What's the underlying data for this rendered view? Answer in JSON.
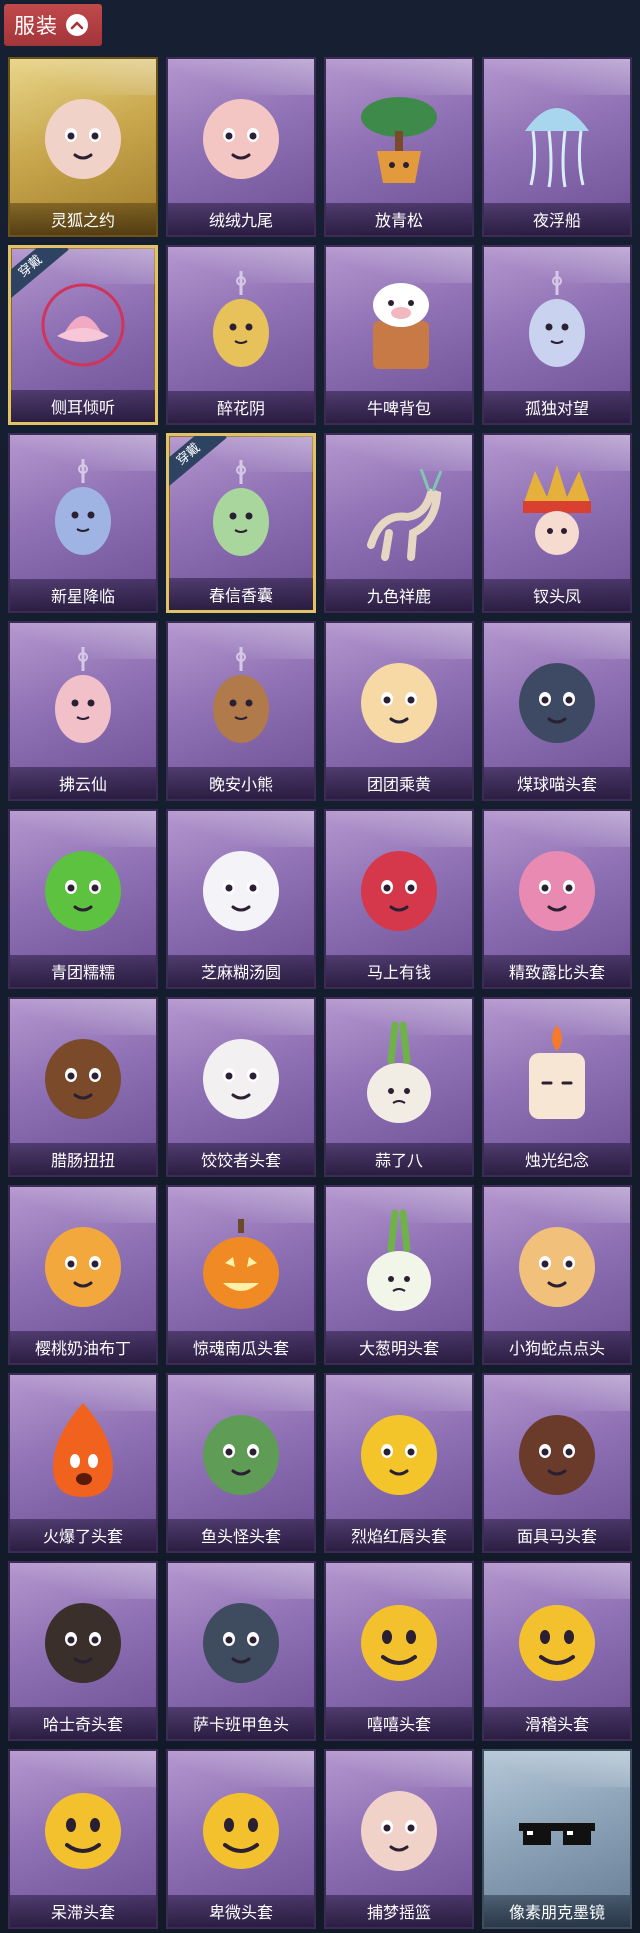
{
  "section": {
    "title": "服装",
    "toggle_icon": "chevron-up-icon"
  },
  "badge_label": "穿戴",
  "items": [
    {
      "label": "灵狐之约",
      "tier": "gold",
      "equipped": false,
      "icon": "fox-doll-icon",
      "color": "#f1d2c8"
    },
    {
      "label": "绒绒九尾",
      "tier": "purple",
      "equipped": false,
      "icon": "nine-tail-fox-icon",
      "color": "#f3c6c4"
    },
    {
      "label": "放青松",
      "tier": "purple",
      "equipped": false,
      "icon": "bonsai-pine-icon",
      "color": "#3e8a4a"
    },
    {
      "label": "夜浮船",
      "tier": "purple",
      "equipped": false,
      "icon": "jellyfish-icon",
      "color": "#a9d6ef"
    },
    {
      "label": "侧耳倾听",
      "tier": "purple",
      "equipped": true,
      "icon": "lotus-wreath-icon",
      "color": "#f2a9c4"
    },
    {
      "label": "醉花阴",
      "tier": "purple",
      "equipped": false,
      "icon": "dreamcatcher-icon",
      "color": "#e7c25a"
    },
    {
      "label": "牛啤背包",
      "tier": "purple",
      "equipped": false,
      "icon": "cow-beer-icon",
      "color": "#c77a45"
    },
    {
      "label": "孤独对望",
      "tier": "purple",
      "equipped": false,
      "icon": "maiden-charm-icon",
      "color": "#c9d2ef"
    },
    {
      "label": "新星降临",
      "tier": "purple",
      "equipped": false,
      "icon": "star-doll-icon",
      "color": "#9fb4e2"
    },
    {
      "label": "春信香囊",
      "tier": "purple",
      "equipped": true,
      "icon": "sachet-icon",
      "color": "#a9d69c"
    },
    {
      "label": "九色祥鹿",
      "tier": "purple",
      "equipped": false,
      "icon": "deer-icon",
      "color": "#e6d7c2"
    },
    {
      "label": "钗头凤",
      "tier": "purple",
      "equipped": false,
      "icon": "phoenix-crown-icon",
      "color": "#d9402f"
    },
    {
      "label": "拂云仙",
      "tier": "purple",
      "equipped": false,
      "icon": "fairy-charm-icon",
      "color": "#f1c0c8"
    },
    {
      "label": "晚安小熊",
      "tier": "purple",
      "equipped": false,
      "icon": "teddy-bear-icon",
      "color": "#b07a4a"
    },
    {
      "label": "团团乘黄",
      "tier": "purple",
      "equipped": false,
      "icon": "round-beast-icon",
      "color": "#f6d9a4"
    },
    {
      "label": "煤球喵头套",
      "tier": "purple",
      "equipped": false,
      "icon": "black-cat-head-icon",
      "color": "#3e4a63"
    },
    {
      "label": "青团糯糯",
      "tier": "purple",
      "equipped": false,
      "icon": "green-dumpling-icon",
      "color": "#5cc23f"
    },
    {
      "label": "芝麻糊汤圆",
      "tier": "purple",
      "equipped": false,
      "icon": "rice-ball-icon",
      "color": "#f4f4f8"
    },
    {
      "label": "马上有钱",
      "tier": "purple",
      "equipped": false,
      "icon": "red-horse-head-icon",
      "color": "#d6384b"
    },
    {
      "label": "精致露比头套",
      "tier": "purple",
      "equipped": false,
      "icon": "pink-beaver-head-icon",
      "color": "#e98ab3"
    },
    {
      "label": "腊肠扭扭",
      "tier": "purple",
      "equipped": false,
      "icon": "dachshund-head-icon",
      "color": "#7a4a2a"
    },
    {
      "label": "饺饺者头套",
      "tier": "purple",
      "equipped": false,
      "icon": "dumpling-head-icon",
      "color": "#f2f0f0"
    },
    {
      "label": "蒜了八",
      "tier": "purple",
      "equipped": false,
      "icon": "garlic-icon",
      "color": "#f1ede4"
    },
    {
      "label": "烛光纪念",
      "tier": "purple",
      "equipped": false,
      "icon": "candle-head-icon",
      "color": "#f7e6d3"
    },
    {
      "label": "樱桃奶油布丁",
      "tier": "purple",
      "equipped": false,
      "icon": "pudding-head-icon",
      "color": "#f2a83c"
    },
    {
      "label": "惊魂南瓜头套",
      "tier": "purple",
      "equipped": false,
      "icon": "pumpkin-head-icon",
      "color": "#ef8a24"
    },
    {
      "label": "大葱明头套",
      "tier": "purple",
      "equipped": false,
      "icon": "scallion-head-icon",
      "color": "#79c24f"
    },
    {
      "label": "小狗蛇点点头",
      "tier": "purple",
      "equipped": false,
      "icon": "snake-dog-head-icon",
      "color": "#f1c07a"
    },
    {
      "label": "火爆了头套",
      "tier": "purple",
      "equipped": false,
      "icon": "fire-head-icon",
      "color": "#f0621e"
    },
    {
      "label": "鱼头怪头套",
      "tier": "purple",
      "equipped": false,
      "icon": "fish-head-icon",
      "color": "#5f9c56"
    },
    {
      "label": "烈焰红唇头套",
      "tier": "purple",
      "equipped": false,
      "icon": "yellow-mascot-head-icon",
      "color": "#f3c52b"
    },
    {
      "label": "面具马头套",
      "tier": "purple",
      "equipped": false,
      "icon": "horse-mask-icon",
      "color": "#6a3a2a"
    },
    {
      "label": "哈士奇头套",
      "tier": "purple",
      "equipped": false,
      "icon": "husky-head-icon",
      "color": "#3a2f2a"
    },
    {
      "label": "萨卡班甲鱼头",
      "tier": "purple",
      "equipped": false,
      "icon": "sacabambaspis-head-icon",
      "color": "#3f4b5e"
    },
    {
      "label": "嘻嘻头套",
      "tier": "purple",
      "equipped": false,
      "icon": "grin-emoji-head-icon",
      "color": "#f4c12e"
    },
    {
      "label": "滑稽头套",
      "tier": "purple",
      "equipped": false,
      "icon": "funny-emoji-head-icon",
      "color": "#f4c12e"
    },
    {
      "label": "呆滞头套",
      "tier": "purple",
      "equipped": false,
      "icon": "dazed-emoji-head-icon",
      "color": "#f4c12e"
    },
    {
      "label": "卑微头套",
      "tier": "purple",
      "equipped": false,
      "icon": "pleading-emoji-head-icon",
      "color": "#f4c12e"
    },
    {
      "label": "捕梦摇篮",
      "tier": "purple",
      "equipped": false,
      "icon": "doll-face-icon",
      "color": "#f1d2c8"
    },
    {
      "label": "像素朋克墨镜",
      "tier": "silver",
      "equipped": false,
      "icon": "pixel-sunglasses-icon",
      "color": "#111111"
    }
  ]
}
